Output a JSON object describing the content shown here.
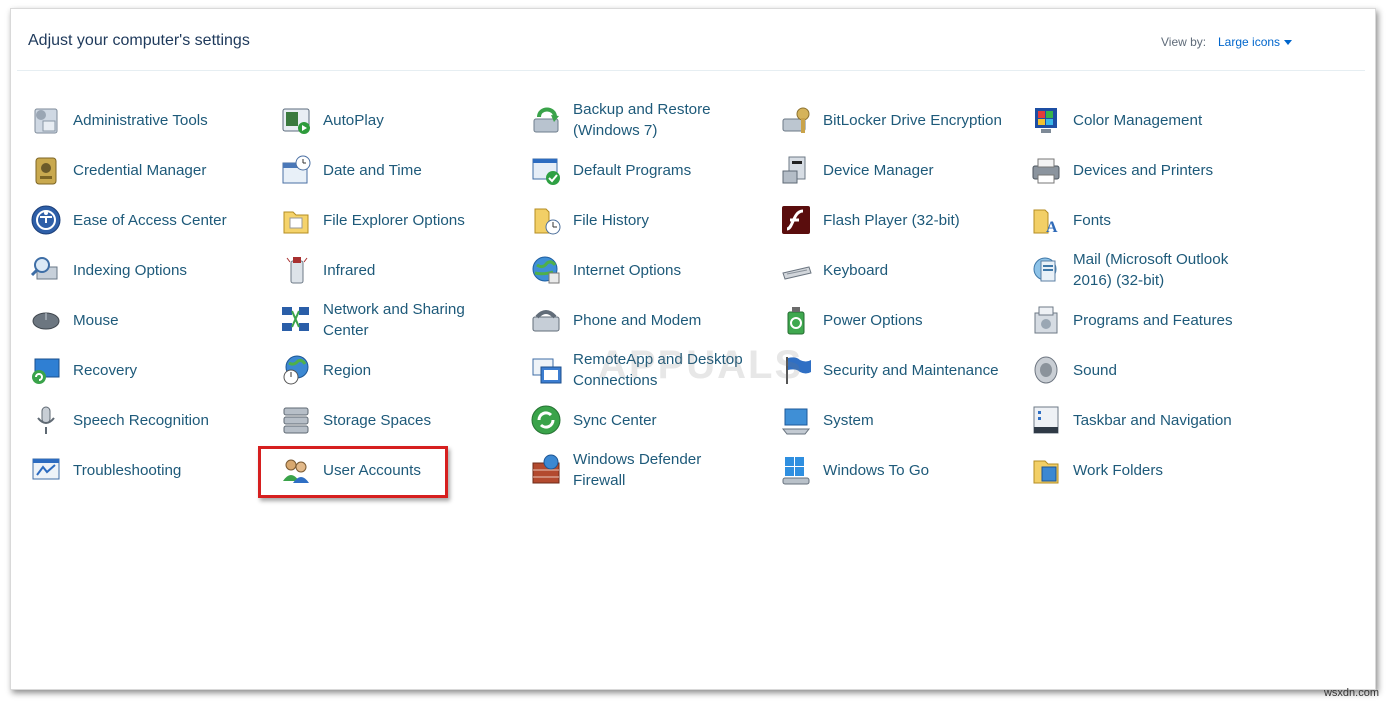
{
  "header": {
    "title": "Adjust your computer's settings",
    "view_by_label": "View by:",
    "view_by_value": "Large icons"
  },
  "items": [
    {
      "label": "Administrative Tools",
      "icon": "admin-tools-icon"
    },
    {
      "label": "AutoPlay",
      "icon": "autoplay-icon"
    },
    {
      "label": "Backup and Restore\n(Windows 7)",
      "icon": "backup-icon"
    },
    {
      "label": "BitLocker Drive Encryption",
      "icon": "bitlocker-icon"
    },
    {
      "label": "Color Management",
      "icon": "color-management-icon"
    },
    {
      "label": "Credential Manager",
      "icon": "credential-manager-icon"
    },
    {
      "label": "Date and Time",
      "icon": "date-time-icon"
    },
    {
      "label": "Default Programs",
      "icon": "default-programs-icon"
    },
    {
      "label": "Device Manager",
      "icon": "device-manager-icon"
    },
    {
      "label": "Devices and Printers",
      "icon": "printer-icon"
    },
    {
      "label": "Ease of Access Center",
      "icon": "ease-of-access-icon"
    },
    {
      "label": "File Explorer Options",
      "icon": "folder-options-icon"
    },
    {
      "label": "File History",
      "icon": "file-history-icon"
    },
    {
      "label": "Flash Player (32-bit)",
      "icon": "flash-icon"
    },
    {
      "label": "Fonts",
      "icon": "fonts-icon"
    },
    {
      "label": "Indexing Options",
      "icon": "indexing-icon"
    },
    {
      "label": "Infrared",
      "icon": "infrared-icon"
    },
    {
      "label": "Internet Options",
      "icon": "internet-options-icon"
    },
    {
      "label": "Keyboard",
      "icon": "keyboard-icon"
    },
    {
      "label": "Mail (Microsoft Outlook\n2016) (32-bit)",
      "icon": "mail-icon"
    },
    {
      "label": "Mouse",
      "icon": "mouse-icon"
    },
    {
      "label": "Network and Sharing\nCenter",
      "icon": "network-icon"
    },
    {
      "label": "Phone and Modem",
      "icon": "phone-modem-icon"
    },
    {
      "label": "Power Options",
      "icon": "power-options-icon"
    },
    {
      "label": "Programs and Features",
      "icon": "programs-features-icon"
    },
    {
      "label": "Recovery",
      "icon": "recovery-icon"
    },
    {
      "label": "Region",
      "icon": "region-icon"
    },
    {
      "label": "RemoteApp and Desktop\nConnections",
      "icon": "remoteapp-icon"
    },
    {
      "label": "Security and Maintenance",
      "icon": "security-flag-icon"
    },
    {
      "label": "Sound",
      "icon": "sound-icon"
    },
    {
      "label": "Speech Recognition",
      "icon": "microphone-icon"
    },
    {
      "label": "Storage Spaces",
      "icon": "storage-spaces-icon"
    },
    {
      "label": "Sync Center",
      "icon": "sync-center-icon"
    },
    {
      "label": "System",
      "icon": "system-icon"
    },
    {
      "label": "Taskbar and Navigation",
      "icon": "taskbar-icon"
    },
    {
      "label": "Troubleshooting",
      "icon": "troubleshooting-icon"
    },
    {
      "label": "User Accounts",
      "icon": "user-accounts-icon"
    },
    {
      "label": "Windows Defender\nFirewall",
      "icon": "firewall-icon"
    },
    {
      "label": "Windows To Go",
      "icon": "windows-to-go-icon"
    },
    {
      "label": "Work Folders",
      "icon": "work-folders-icon"
    }
  ],
  "highlighted_item": "User Accounts",
  "watermark": "APPUALS",
  "footer_mark": "wsxdn.com",
  "colors": {
    "link": "#1e5a7a",
    "title": "#1e395b",
    "accent": "#0066cc",
    "highlight": "#d61f1f"
  }
}
